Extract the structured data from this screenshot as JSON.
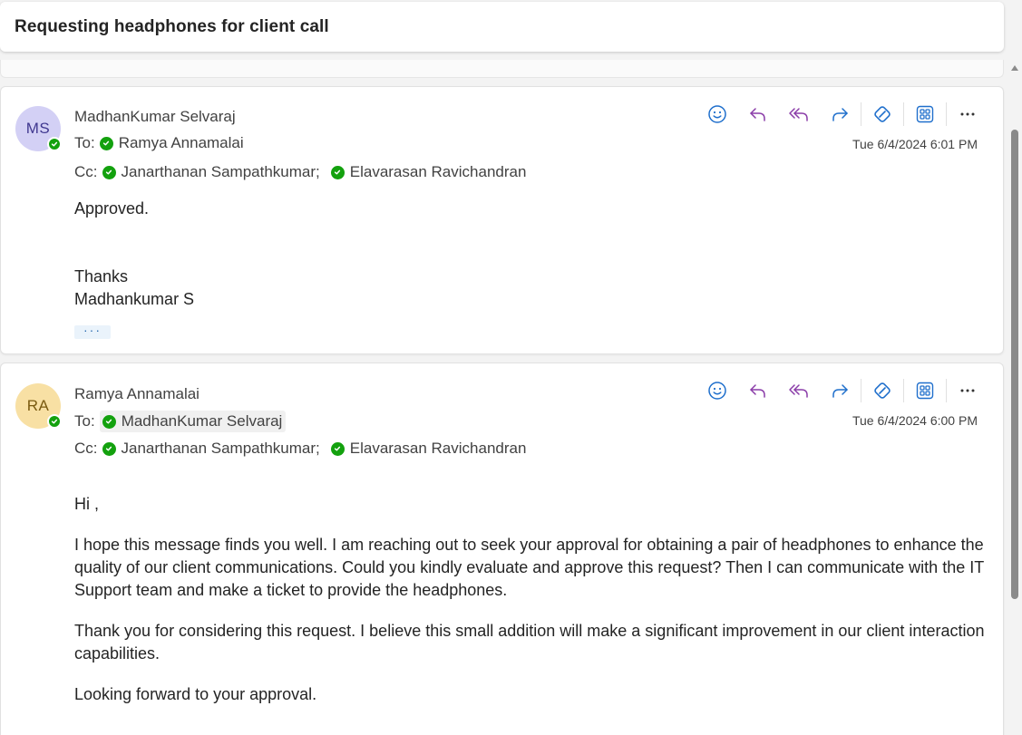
{
  "subject": "Requesting headphones for client call",
  "colors": {
    "presence_green": "#13a10e",
    "action_blue": "#1f6fcc",
    "action_purple": "#8a3ca8"
  },
  "actions": [
    {
      "name": "emoji-react",
      "icon": "smiley-icon"
    },
    {
      "name": "reply",
      "icon": "reply-icon"
    },
    {
      "name": "reply-all",
      "icon": "reply-all-icon"
    },
    {
      "name": "forward",
      "icon": "forward-icon"
    },
    {
      "name": "viva-insights",
      "icon": "viva-icon"
    },
    {
      "name": "apps",
      "icon": "apps-grid-icon"
    },
    {
      "name": "more-actions",
      "icon": "more-icon"
    }
  ],
  "messages": [
    {
      "initials": "MS",
      "sender": "MadhanKumar Selvaraj",
      "to_label": "To:",
      "to": [
        "Ramya Annamalai"
      ],
      "cc_label": "Cc:",
      "cc": [
        "Janarthanan Sampathkumar;",
        "Elavarasan Ravichandran"
      ],
      "timestamp": "Tue 6/4/2024 6:01 PM",
      "body": [
        "Approved.",
        "Thanks",
        "Madhankumar S"
      ],
      "expand_label": "···"
    },
    {
      "initials": "RA",
      "sender": "Ramya Annamalai",
      "to_label": "To:",
      "to": [
        "MadhanKumar Selvaraj"
      ],
      "cc_label": "Cc:",
      "cc": [
        "Janarthanan Sampathkumar;",
        "Elavarasan Ravichandran"
      ],
      "timestamp": "Tue 6/4/2024 6:00 PM",
      "body": [
        "Hi ,",
        "I hope this message finds you well. I am reaching out to seek your approval for obtaining a pair of headphones to enhance the quality of our client communications. Could you kindly evaluate and approve this request? Then I can communicate with the IT Support team and make a ticket to provide the headphones.",
        "Thank you for considering this request. I believe this small addition will make a significant improvement in our client interaction capabilities.",
        "Looking forward to your approval."
      ]
    }
  ]
}
